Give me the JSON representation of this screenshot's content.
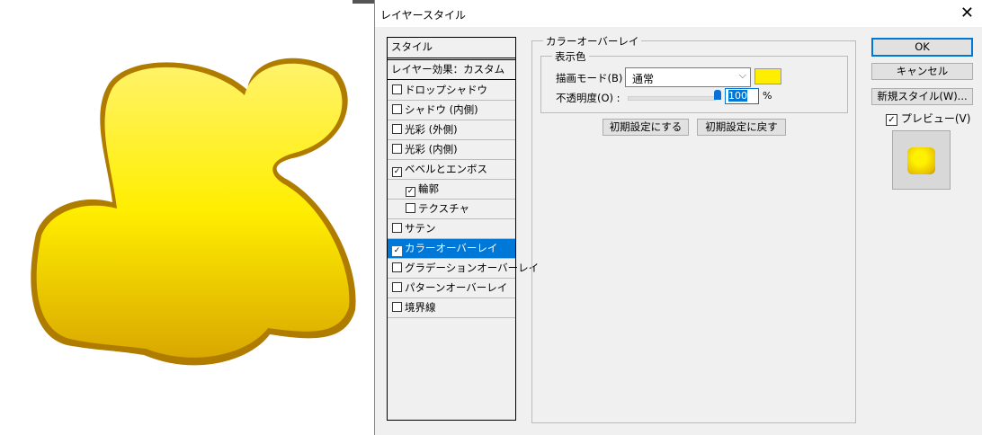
{
  "dialog": {
    "title": "レイヤースタイル"
  },
  "styles_list": {
    "header": "スタイル",
    "blend_options": "レイヤー効果：カスタム",
    "items": [
      {
        "label": "ドロップシャドウ",
        "checked": false
      },
      {
        "label": "シャドウ (内側)",
        "checked": false
      },
      {
        "label": "光彩 (外側)",
        "checked": false
      },
      {
        "label": "光彩 (内側)",
        "checked": false
      },
      {
        "label": "ベベルとエンボス",
        "checked": true
      },
      {
        "label": "輪郭",
        "checked": true
      },
      {
        "label": "テクスチャ",
        "checked": false
      },
      {
        "label": "サテン",
        "checked": false
      },
      {
        "label": "カラーオーバーレイ",
        "checked": true,
        "selected": true
      },
      {
        "label": "グラデーションオーバーレイ",
        "checked": false
      },
      {
        "label": "パターンオーバーレイ",
        "checked": false
      },
      {
        "label": "境界線",
        "checked": false
      }
    ]
  },
  "panel": {
    "title": "カラーオーバーレイ",
    "subgroup": "表示色",
    "blend_mode_label": "描画モード(B) :",
    "blend_mode_value": "通常",
    "overlay_color": "#ffee00",
    "opacity_label": "不透明度(O) :",
    "opacity_value": "100",
    "opacity_unit": "%",
    "make_default": "初期設定にする",
    "reset_default": "初期設定に戻す"
  },
  "buttons": {
    "ok": "OK",
    "cancel": "キャンセル",
    "new_style": "新規スタイル(W)..."
  },
  "preview": {
    "label": "プレビュー(V)",
    "checked": true
  }
}
